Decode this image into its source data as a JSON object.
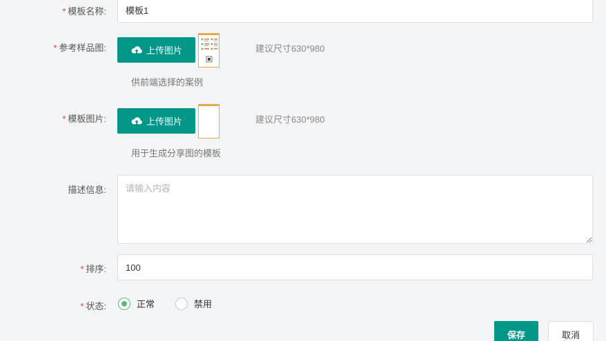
{
  "form": {
    "template_name": {
      "label": "模板名称:",
      "value": "模板1"
    },
    "sample_image": {
      "label": "参考样品图:",
      "upload_label": "上传图片",
      "size_hint": "建议尺寸630*980",
      "help": "供前端选择的案例"
    },
    "template_image": {
      "label": "模板图片:",
      "upload_label": "上传图片",
      "size_hint": "建议尺寸630*980",
      "help": "用于生成分享图的模板"
    },
    "description": {
      "label": "描述信息:",
      "placeholder": "请输入内容",
      "value": ""
    },
    "sort": {
      "label": "排序:",
      "value": "100"
    },
    "status": {
      "label": "状态:",
      "options": [
        "正常",
        "禁用"
      ],
      "selected": "正常"
    }
  },
  "actions": {
    "save_label": "保存",
    "cancel_label": "取消"
  },
  "required_mark": "*",
  "icons": {
    "upload": "cloud-upload-icon"
  },
  "colors": {
    "primary": "#009688",
    "radio_active": "#5fb878",
    "required": "#e4393c",
    "thumb_border": "#e8a84a"
  }
}
